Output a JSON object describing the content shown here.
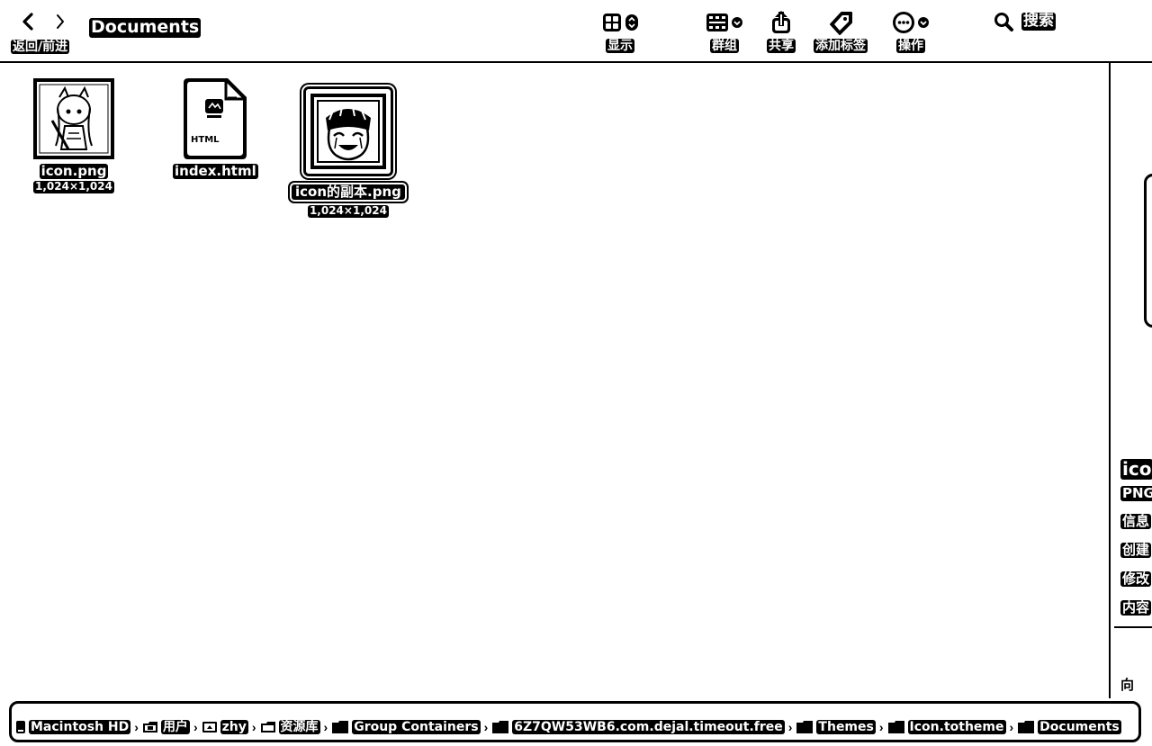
{
  "toolbar": {
    "nav_label": "返回/前进",
    "title": "Documents",
    "view_label": "显示",
    "group_label": "群组",
    "share_label": "共享",
    "tag_label": "添加标签",
    "action_label": "操作",
    "search_label": "搜索",
    "icons": {
      "back": "chevron-left-icon",
      "forward": "chevron-right-icon",
      "view": "grid-view-icon",
      "group": "group-list-icon",
      "share": "share-icon",
      "tag": "tag-icon",
      "action": "ellipsis-circle-icon",
      "search": "magnifier-icon"
    }
  },
  "files": [
    {
      "name": "icon.png",
      "meta": "1,024×1,024",
      "kind": "image",
      "selected": false
    },
    {
      "name": "index.html",
      "meta": "",
      "kind": "html",
      "badge": "HTML",
      "selected": false
    },
    {
      "name": "icon的副本.png",
      "meta": "1,024×1,024",
      "kind": "image",
      "selected": true
    }
  ],
  "preview": {
    "title": "ico",
    "type": "PNG",
    "info": "信息",
    "created": "创建",
    "modified": "修改",
    "content": "内容",
    "more": "向"
  },
  "pathbar": [
    {
      "label": "Macintosh HD",
      "icon": "disk-icon"
    },
    {
      "label": "用户",
      "icon": "folder-icon"
    },
    {
      "label": "zhy",
      "icon": "home-icon"
    },
    {
      "label": "资源库",
      "icon": "folder-icon"
    },
    {
      "label": "Group Containers",
      "icon": "folder-icon"
    },
    {
      "label": "6Z7QW53WB6.com.dejal.timeout.free",
      "icon": "folder-icon"
    },
    {
      "label": "Themes",
      "icon": "folder-icon"
    },
    {
      "label": "Icon.totheme",
      "icon": "folder-icon"
    },
    {
      "label": "Documents",
      "icon": "folder-icon"
    }
  ],
  "colors": {
    "foreground": "#000000",
    "background": "#ffffff"
  }
}
